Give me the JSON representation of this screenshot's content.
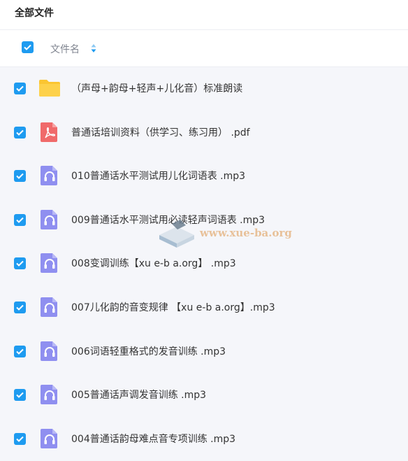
{
  "topbar": {
    "title": "全部文件"
  },
  "header": {
    "column_name": "文件名"
  },
  "files": [
    {
      "name": "（声母+韵母+轻声+儿化音）标准朗读",
      "icon": "folder-icon"
    },
    {
      "name": "普通话培训资料（供学习、练习用） .pdf",
      "icon": "pdf-icon"
    },
    {
      "name": "010普通话水平测试用儿化词语表 .mp3",
      "icon": "audio-file-icon"
    },
    {
      "name": "009普通话水平测试用必读轻声词语表 .mp3",
      "icon": "audio-file-icon"
    },
    {
      "name": "008变调训练【xu e-b a.org】 .mp3",
      "icon": "audio-file-icon"
    },
    {
      "name": "007儿化韵的音变规律 【xu e-b a.org】.mp3",
      "icon": "audio-file-icon"
    },
    {
      "name": "006词语轻重格式的发音训练 .mp3",
      "icon": "audio-file-icon"
    },
    {
      "name": "005普通话声调发音训练 .mp3",
      "icon": "audio-file-icon"
    },
    {
      "name": "004普通话韵母难点音专项训练 .mp3",
      "icon": "audio-file-icon"
    }
  ],
  "watermark": {
    "text": "www.xue-ba.org"
  },
  "colors": {
    "accent": "#1e9bf0",
    "folder": "#fbc531",
    "pdf": "#f06a6a",
    "audio": "#8f8ff0"
  }
}
